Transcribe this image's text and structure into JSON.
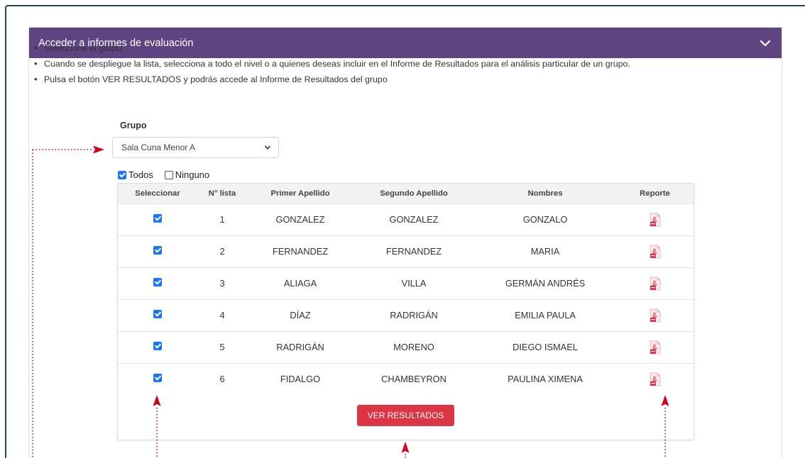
{
  "panel": {
    "title": "Acceder a informes de evaluación",
    "header_color": "#5f4482"
  },
  "instructions": [
    "Selecciona el grupo.",
    "Cuando se despliegue la lista, selecciona a todo el nivel o a quienes deseas incluir en el Informe de Resultados para el análisis particular de un grupo.",
    "Pulsa el botón VER RESULTADOS y podrás accede al Informe de Resultados del grupo"
  ],
  "group": {
    "label": "Grupo",
    "selected": "Sala Cuna Menor A"
  },
  "selection": {
    "all_label": "Todos",
    "none_label": "Ninguno",
    "all_checked": true,
    "none_checked": false
  },
  "table": {
    "headers": [
      "Seleccionar",
      "N° lista",
      "Primer Apellido",
      "Segundo Apellido",
      "Nombres",
      "Reporte"
    ],
    "rows": [
      {
        "checked": true,
        "num": "1",
        "apellido1": "GONZALEZ",
        "apellido2": "GONZALEZ",
        "nombres": "GONZALO"
      },
      {
        "checked": true,
        "num": "2",
        "apellido1": "FERNANDEZ",
        "apellido2": "FERNANDEZ",
        "nombres": "MARIA"
      },
      {
        "checked": true,
        "num": "3",
        "apellido1": "ALIAGA",
        "apellido2": "VILLA",
        "nombres": "GERMÁN ANDRÉS"
      },
      {
        "checked": true,
        "num": "4",
        "apellido1": "DÍAZ",
        "apellido2": "RADRIGÁN",
        "nombres": "EMILIA PAULA"
      },
      {
        "checked": true,
        "num": "5",
        "apellido1": "RADRIGÁN",
        "apellido2": "MORENO",
        "nombres": "DIEGO ISMAEL"
      },
      {
        "checked": true,
        "num": "6",
        "apellido1": "FIDALGO",
        "apellido2": "CHAMBEYRON",
        "nombres": "PAULINA XIMENA"
      }
    ],
    "report_icon": "pdf-icon"
  },
  "button": {
    "label": "VER RESULTADOS",
    "color": "#dc3545"
  },
  "colors": {
    "accent": "#1877f2",
    "annotation": "#d0021b",
    "frame": "#1d4b5a"
  }
}
